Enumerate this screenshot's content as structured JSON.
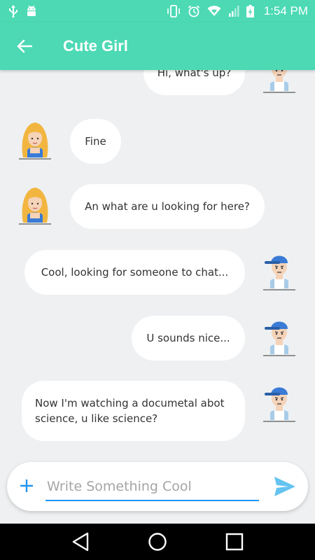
{
  "status_bar": {
    "time": "1:54 PM",
    "left_icons": [
      "usb-icon",
      "android-icon"
    ],
    "right_icons": [
      "vibrate-icon",
      "alarm-icon",
      "wifi-icon",
      "signal-icon",
      "battery-charging-icon"
    ]
  },
  "header": {
    "title": "Cute Girl",
    "back_icon": "arrow-left-icon"
  },
  "messages": [
    {
      "sender": "me",
      "text": "Hi, what's up?"
    },
    {
      "sender": "her",
      "text": "Fine"
    },
    {
      "sender": "her",
      "text": "An what are u looking for here?"
    },
    {
      "sender": "me",
      "text": "Cool, looking for someone to chat..."
    },
    {
      "sender": "me",
      "text": "U sounds nice..."
    },
    {
      "sender": "me",
      "text": "Now I'm watching a documetal abot science, u like science?"
    }
  ],
  "composer": {
    "placeholder": "Write Something Cool",
    "value": "",
    "add_icon": "plus-icon",
    "send_icon": "send-icon"
  },
  "nav_bar": {
    "icons": [
      "back-triangle-icon",
      "home-circle-icon",
      "recents-square-icon"
    ]
  },
  "colors": {
    "primary": "#4cd9b4",
    "background": "#eef0f2",
    "bubble": "#ffffff",
    "accent": "#2196f3",
    "send": "#64c3f0"
  }
}
